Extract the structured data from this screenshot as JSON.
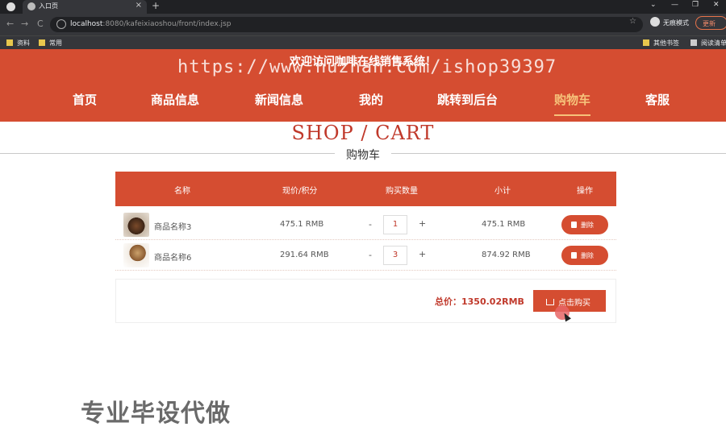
{
  "browser": {
    "tab_title": "入口页",
    "tab_close": "×",
    "new_tab": "+",
    "url_host": "localhost",
    "url_rest": ":8080/kafeixiaoshou/front/index.jsp",
    "incognito_label": "无痕模式",
    "update_label": "更新",
    "window_minimize": "—",
    "window_restore": "❐",
    "window_close": "✕",
    "nav_back": "←",
    "nav_forward": "→",
    "nav_reload": "C",
    "star": "☆",
    "bookmarks": [
      "资料",
      "常用"
    ],
    "bookmarks_right": [
      "其他书签",
      "阅读清单"
    ]
  },
  "header": {
    "welcome": "欢迎访问咖啡在线销售系统！",
    "overlay_watermark": "https://www.huzhan.com/ishop39397",
    "nav": [
      {
        "label": "首页"
      },
      {
        "label": "商品信息"
      },
      {
        "label": "新闻信息"
      },
      {
        "label": "我的"
      },
      {
        "label": "跳转到后台"
      },
      {
        "label": "购物车",
        "active": true
      },
      {
        "label": "客服"
      }
    ]
  },
  "page": {
    "title": "SHOP / CART",
    "subtitle": "购物车"
  },
  "table": {
    "headers": [
      "名称",
      "现价/积分",
      "购买数量",
      "小计",
      "操作"
    ],
    "rows": [
      {
        "name": "商品名称3",
        "price": "475.1 RMB",
        "qty": "1",
        "subtotal": "475.1 RMB",
        "action": "删除"
      },
      {
        "name": "商品名称6",
        "price": "291.64 RMB",
        "qty": "3",
        "subtotal": "874.92 RMB",
        "action": "删除"
      }
    ],
    "minus": "-",
    "plus": "+"
  },
  "summary": {
    "total": "总价：1350.02RMB",
    "buy_label": "点击购买"
  },
  "bottom_watermark": "专业毕设代做",
  "colors": {
    "brand_red": "#d54d31",
    "active_nav": "#f6c27a",
    "title_red": "#c0392b"
  }
}
